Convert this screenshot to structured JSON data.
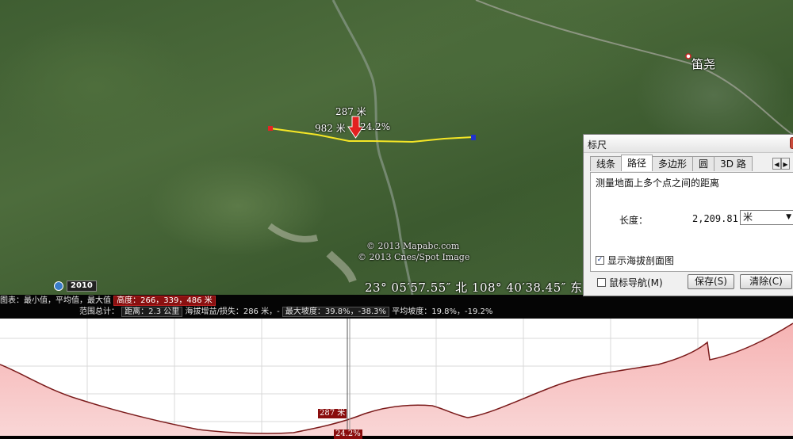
{
  "map": {
    "measure": {
      "elevation_label": "287 米",
      "distance_label": "982 米",
      "grade_label": "24.2%"
    },
    "copyright": [
      "© 2013 Mapabc.com",
      "© 2013 Cnes/Spot Image"
    ],
    "coordinates": "23° 05′57.55″ 北 108° 40′38.45″ 东",
    "town_label": "笛尧",
    "imagery_year": "2010",
    "colors": {
      "path": "#f5e626",
      "start_marker": "#e32424",
      "end_marker": "#2233cc",
      "arrow": "#e32020"
    }
  },
  "info_bar": {
    "row1_prefix": "图表：最小值，平均值，最大值",
    "row1_box": "高度：266，339，486 米",
    "row2_prefix": "范围总计：",
    "row2_box1": "距离：2.3 公里",
    "row2_mid": "海拔增益/损失：286 米，-",
    "row2_box2": "最大坡度：39.8%，-38.3%",
    "row2_tail": "平均坡度：19.8%，-19.2%"
  },
  "profile": {
    "elevation_tag": "287 米",
    "grade_tag": "24.2%"
  },
  "ruler": {
    "title": "标尺",
    "tabs": [
      "线条",
      "路径",
      "多边形",
      "圆",
      "3D 路"
    ],
    "active_tab": "路径",
    "description": "测量地面上多个点之间的距离",
    "length_label": "长度：",
    "length_value": "2,209.81",
    "unit": "米",
    "show_profile_label": "显示海拔剖面图",
    "mouse_nav_label": "鼠标导航(M)",
    "save_label": "保存(S)",
    "clear_label": "清除(C)"
  }
}
